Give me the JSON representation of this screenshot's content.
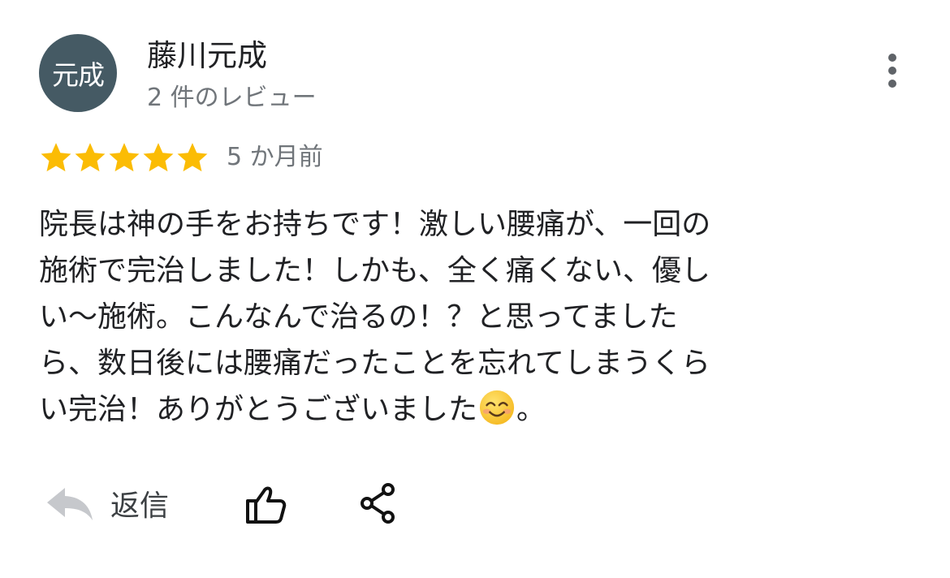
{
  "reviewer": {
    "avatar_text": "元成",
    "avatar_color": "#455a64",
    "name": "藤川元成",
    "review_count": "2 件のレビュー"
  },
  "menu": {
    "icon": "more-vert-icon"
  },
  "rating": {
    "stars": 5,
    "max_stars": 5,
    "star_color": "#fbbc04"
  },
  "date": "5 か月前",
  "review": {
    "lines": [
      "院長は神の手をお持ちです！激しい腰痛が、一回の",
      "施術で完治しました！しかも、全く痛くない、優し",
      "い〜施術。こんなんで治るの！？と思ってました",
      "ら、数日後には腰痛だったことを忘れてしまうくら",
      "い完治！ありがとうございました"
    ],
    "last_line_emoji": "smiling-face-emoji",
    "last_line_tail": "。"
  },
  "actions": {
    "reply_label": "返信",
    "reply_icon": "reply-arrow-icon",
    "like_icon": "thumbs-up-icon",
    "share_icon": "share-icon"
  }
}
